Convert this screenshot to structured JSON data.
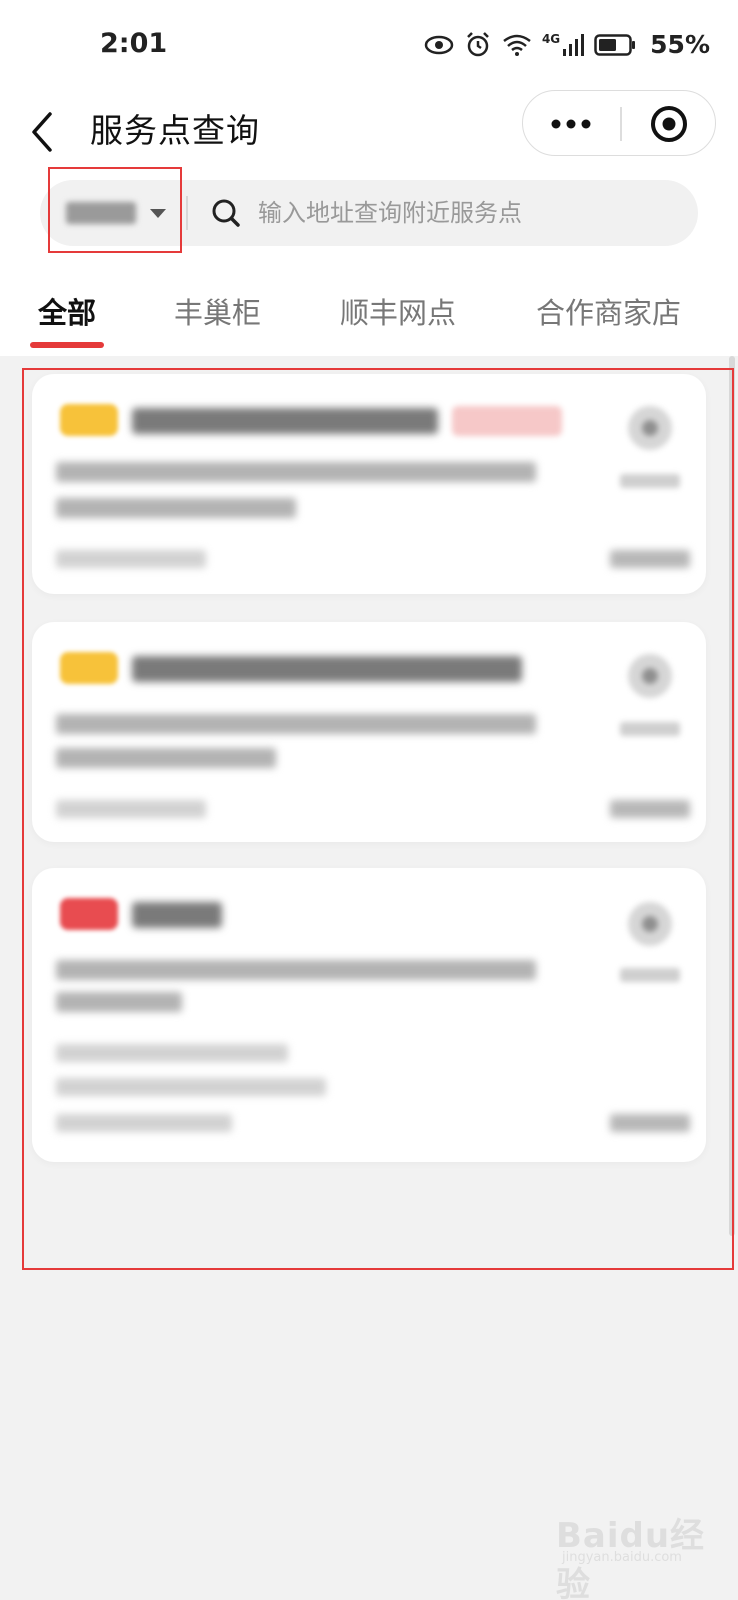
{
  "status_bar": {
    "time": "2:01",
    "network": "4G",
    "battery_percent": "55%",
    "icons": [
      "eye-icon",
      "alarm-icon",
      "wifi-icon",
      "signal-icon",
      "battery-icon"
    ]
  },
  "header": {
    "title": "服务点查询"
  },
  "search": {
    "city": "",
    "placeholder": "输入地址查询附近服务点"
  },
  "tabs": [
    {
      "label": "全部",
      "active": true
    },
    {
      "label": "丰巢柜",
      "active": false
    },
    {
      "label": "顺丰网点",
      "active": false
    },
    {
      "label": "合作商家店",
      "active": false
    }
  ],
  "cards": [
    {
      "badge_color": "#f7c23a",
      "has_tag": true
    },
    {
      "badge_color": "#f7c23a",
      "has_tag": false
    },
    {
      "badge_color": "#e84c50",
      "has_tag": false
    }
  ],
  "watermark": {
    "brand": "Baidu经验",
    "sub": "jingyan.baidu.com"
  },
  "colors": {
    "accent": "#e53a3a",
    "badge_yellow": "#f7c23a",
    "badge_red": "#e84c50"
  }
}
